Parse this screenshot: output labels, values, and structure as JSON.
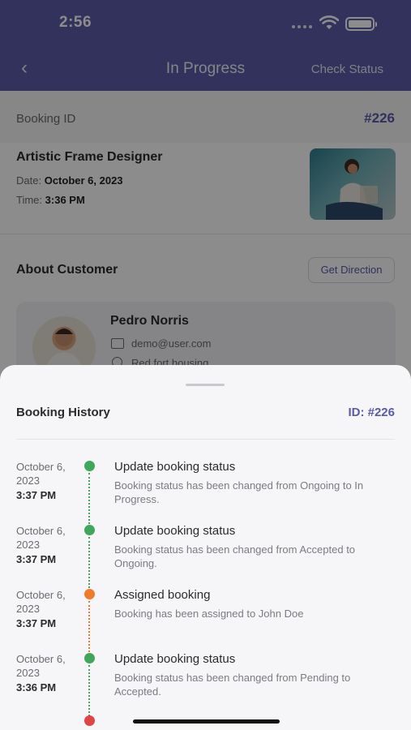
{
  "status_bar": {
    "time": "2:56"
  },
  "nav": {
    "back_label": "‹",
    "title": "In Progress",
    "action": "Check Status"
  },
  "booking": {
    "id_label": "Booking ID",
    "id_value": "#226",
    "service_name": "Artistic Frame Designer",
    "date_label": "Date:",
    "date_value": "October 6, 2023",
    "time_label": "Time:",
    "time_value": "3:36 PM"
  },
  "customer": {
    "section_title": "About Customer",
    "direction_button": "Get Direction",
    "name": "Pedro Norris",
    "email": "demo@user.com",
    "address": "Red fort housing"
  },
  "sheet": {
    "title": "Booking History",
    "id_text": "ID:  #226",
    "items": [
      {
        "date": "October 6, 2023",
        "time": "3:37 PM",
        "title": "Update booking status",
        "desc": "Booking status has been changed from Ongoing to In Progress.",
        "dot_color": "#3fa65a"
      },
      {
        "date": "October 6, 2023",
        "time": "3:37 PM",
        "title": "Update booking status",
        "desc": "Booking status has been changed from Accepted to Ongoing.",
        "dot_color": "#3fa65a"
      },
      {
        "date": "October 6, 2023",
        "time": "3:37 PM",
        "title": "Assigned booking",
        "desc": "Booking has been assigned to John Doe",
        "dot_color": "#f07a2e"
      },
      {
        "date": "October 6, 2023",
        "time": "3:36 PM",
        "title": "Update booking status",
        "desc": "Booking status has been changed from Pending to Accepted.",
        "dot_color": "#3fa65a"
      }
    ]
  },
  "colors": {
    "primary": "#5c5ca8",
    "accent_text": "#5a5aa8",
    "green": "#3fa65a",
    "orange": "#f07a2e",
    "red": "#e04444"
  }
}
